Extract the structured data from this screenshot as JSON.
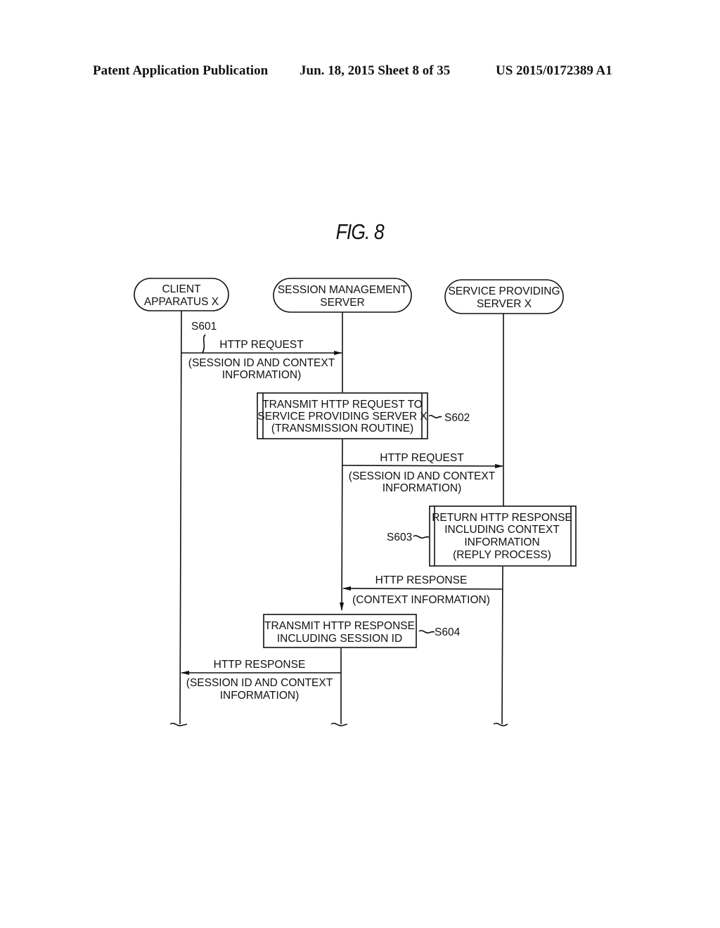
{
  "header": {
    "publication": "Patent Application Publication",
    "date_sheet": "Jun. 18, 2015  Sheet 8 of 35",
    "patent_number": "US 2015/0172389 A1"
  },
  "figure": {
    "title": "FIG. 8"
  },
  "lifelines": [
    {
      "id": "client",
      "lines": [
        "CLIENT",
        "APPARATUS X"
      ]
    },
    {
      "id": "session",
      "lines": [
        "SESSION MANAGEMENT",
        "SERVER"
      ]
    },
    {
      "id": "service",
      "lines": [
        "SERVICE PROVIDING",
        "SERVER X"
      ]
    }
  ],
  "messages": [
    {
      "from": "client",
      "to": "session",
      "label": "HTTP REQUEST",
      "detail": [
        "(SESSION ID AND CONTEXT",
        "INFORMATION)"
      ],
      "step": "S601"
    },
    {
      "from": "session",
      "to": "service",
      "label": "HTTP REQUEST",
      "detail": [
        "(SESSION ID AND CONTEXT",
        "INFORMATION)"
      ]
    },
    {
      "from": "service",
      "to": "session",
      "label": "HTTP RESPONSE",
      "detail": [
        "(CONTEXT INFORMATION)"
      ]
    },
    {
      "from": "session",
      "to": "client",
      "label": "HTTP RESPONSE",
      "detail": [
        "(SESSION ID AND CONTEXT",
        "INFORMATION)"
      ]
    }
  ],
  "processes": [
    {
      "step": "S602",
      "lines": [
        "TRANSMIT HTTP REQUEST TO",
        "SERVICE PROVIDING SERVER X",
        "(TRANSMISSION ROUTINE)"
      ],
      "subroutine": true
    },
    {
      "step": "S603",
      "lines": [
        "RETURN HTTP RESPONSE",
        "INCLUDING CONTEXT",
        "INFORMATION",
        "(REPLY PROCESS)"
      ],
      "subroutine": true
    },
    {
      "step": "S604",
      "lines": [
        "TRANSMIT HTTP RESPONSE",
        "INCLUDING SESSION ID"
      ],
      "subroutine": false
    }
  ]
}
